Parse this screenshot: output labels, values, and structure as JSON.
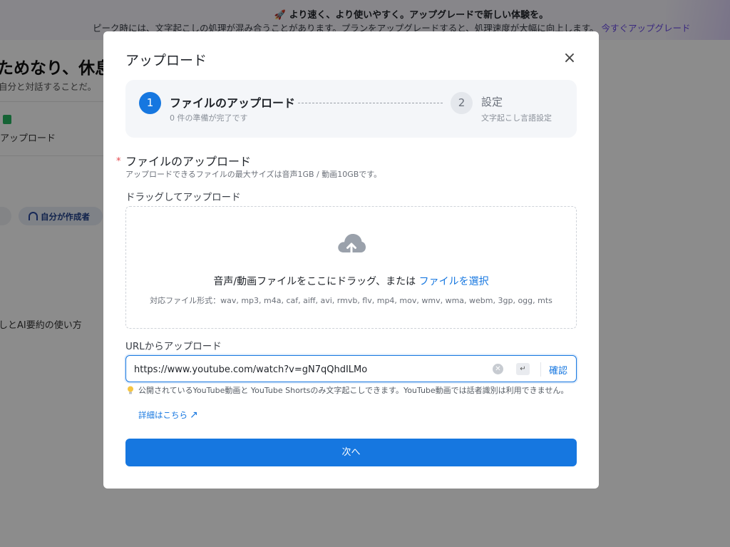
{
  "banner": {
    "rocket_icon": "rocket-icon",
    "title": "より速く、より使いやすく。アップグレードで新しい体験を。",
    "subtitle": "ピーク時には、文字起こしの処理が混み合うことがあります。プランをアップグレードすると、処理速度が大幅に向上します。",
    "link": "今すぐアップグレード"
  },
  "background": {
    "heading": "ためなり、休息",
    "subtext": "自分と対話することだ。",
    "upload_label": "アップロード",
    "author_pill": "自分が作成者",
    "guide_text": "しとAI要約の使い方"
  },
  "modal": {
    "title": "アップロード",
    "close_icon": "close-icon",
    "steps": [
      {
        "number": "1",
        "label": "ファイルのアップロード",
        "sub": "0 件の準備が完了です",
        "active": true
      },
      {
        "number": "2",
        "label": "設定",
        "sub": "文字起こし言語設定",
        "active": false
      }
    ],
    "file_section": {
      "required_mark": "*",
      "title": "ファイルのアップロード",
      "description": "アップロードできるファイルの最大サイズは音声1GB / 動画10GBです。",
      "drag_title": "ドラッグしてアップロード",
      "drop_text": "音声/動画ファイルをここにドラッグ、または",
      "drop_link": "ファイルを選択",
      "formats": "対応ファイル形式：wav, mp3, m4a, caf, aiff, avi, rmvb, flv, mp4, mov, wmv, wma, webm, 3gp, ogg, mts"
    },
    "url_section": {
      "title": "URLからアップロード",
      "value": "https://www.youtube.com/watch?v=gN7qQhdILMo",
      "clear_icon": "clear-icon",
      "enter_icon": "enter-key-icon",
      "enter_glyph": "↵",
      "confirm": "確認",
      "note": "公開されているYouTube動画と YouTube Shortsのみ文字起こしできます。YouTube動画では話者識別は利用できません。",
      "note_link": "詳細はこちら",
      "note_link_arrow": "↗"
    },
    "next_button": "次へ"
  },
  "colors": {
    "primary": "#1677e0",
    "overlay": "rgba(0,0,0,0.45)",
    "upgrade_link": "#6a4ae8",
    "required": "#e5484d"
  }
}
